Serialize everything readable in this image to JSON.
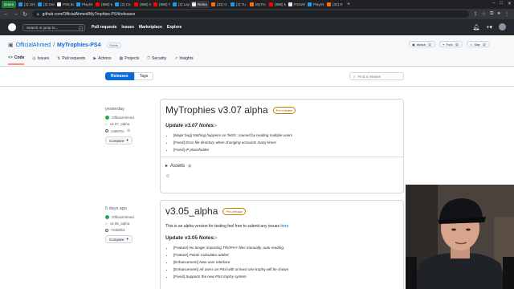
{
  "browser": {
    "tabs": [
      {
        "label": "Green",
        "color": "#1a7f37"
      },
      {
        "label": "(2) Unl",
        "color": "#1d9bf0"
      },
      {
        "label": "(2) Sea",
        "color": "#1d9bf0"
      },
      {
        "label": "PS5 Bu",
        "color": "#e8eaed"
      },
      {
        "label": "PlaySt",
        "color": "#1d9bf0"
      },
      {
        "label": "(996) M",
        "color": "#ff0000"
      },
      {
        "label": "(2) Co",
        "color": "#1d9bf0"
      },
      {
        "label": "(996) S",
        "color": "#ff0000"
      },
      {
        "label": "(996) T",
        "color": "#ff0000"
      },
      {
        "label": "(2) Lay",
        "color": "#1d9bf0"
      },
      {
        "label": "Relea",
        "color": "#e8eaed",
        "active": true
      },
      {
        "label": "(32) G",
        "color": "#ff6d00"
      },
      {
        "label": "(2) Tu",
        "color": "#1d9bf0"
      },
      {
        "label": "MyTro",
        "color": "#ff6d00"
      },
      {
        "label": "(996) M",
        "color": "#ff0000"
      },
      {
        "label": "PS4Wi",
        "color": "#e8eaed"
      },
      {
        "label": "PlaySt",
        "color": "#1d9bf0"
      },
      {
        "label": "(32) R",
        "color": "#ff6d00"
      }
    ],
    "url": "github.com/OfficialAhmed/MyTrophies-PS4/releases"
  },
  "gh": {
    "search_placeholder": "Search or jump to...",
    "nav": [
      "Pull requests",
      "Issues",
      "Marketplace",
      "Explore"
    ]
  },
  "repo": {
    "owner": "OfficialAhmed",
    "name": "MyTrophies-PS4",
    "visibility": "Public",
    "watch_label": "Watch",
    "watch_count": "1",
    "fork_label": "Fork",
    "fork_count": "0",
    "star_label": "Star",
    "star_count": "2",
    "tabs": [
      {
        "label": "Code",
        "icon": "code-icon",
        "glyph": "<>",
        "active": true
      },
      {
        "label": "Issues",
        "icon": "issue-icon",
        "glyph": "◎"
      },
      {
        "label": "Pull requests",
        "icon": "pull-request-icon",
        "glyph": "⇅"
      },
      {
        "label": "Actions",
        "icon": "play-icon",
        "glyph": "▶"
      },
      {
        "label": "Projects",
        "icon": "table-icon",
        "glyph": "▦"
      },
      {
        "label": "Security",
        "icon": "shield-icon",
        "glyph": "⛉"
      },
      {
        "label": "Insights",
        "icon": "graph-icon",
        "glyph": "↗"
      }
    ]
  },
  "toolbar": {
    "releases_label": "Releases",
    "tags_label": "Tags",
    "find_placeholder": "Find a release"
  },
  "releases": [
    {
      "date": "yesterday",
      "author": "OfficialAhmed",
      "tag": "v3.07_alpha",
      "commit": "ca9876c",
      "compare_label": "Compare",
      "title": "MyTrophies v3.07 alpha",
      "badge": "Pre-release",
      "notes_heading": "Update v3.07 Notes:-",
      "notes": [
        {
          "tag": "[Major bug]",
          "text": "Nothing happens on 'fetch', caused by reading multiple users"
        },
        {
          "tag": "[Fixed]",
          "text": "Error file directory when changing accounts many times"
        },
        {
          "tag": "[Fixed]",
          "text": "IP placeholder"
        }
      ],
      "assets_label": "Assets",
      "assets_count": "3"
    },
    {
      "date": "5 days ago",
      "author": "OfficialAhmed",
      "tag": "v3.05_alpha",
      "commit": "723b0b3",
      "compare_label": "Compare",
      "title": "v3.05_alpha",
      "badge": "Pre-release",
      "intro": "This is an alpha version for testing feel free to submit any issues",
      "intro_link": "here",
      "notes_heading": "Update v3.05 Notes:-",
      "notes": [
        {
          "tag": "[Feature]",
          "text": "No longer importing TROPHY files manually, auto reading."
        },
        {
          "tag": "[Feature]",
          "text": "Points Calculator added"
        },
        {
          "tag": "[Enhancement]",
          "text": "New user interface"
        },
        {
          "tag": "[Enhancement]",
          "text": "All users on PS4 with at least one trophy will be shown"
        },
        {
          "tag": "[Fixed]",
          "text": "Supports the new PS4 trophy system"
        }
      ]
    }
  ]
}
